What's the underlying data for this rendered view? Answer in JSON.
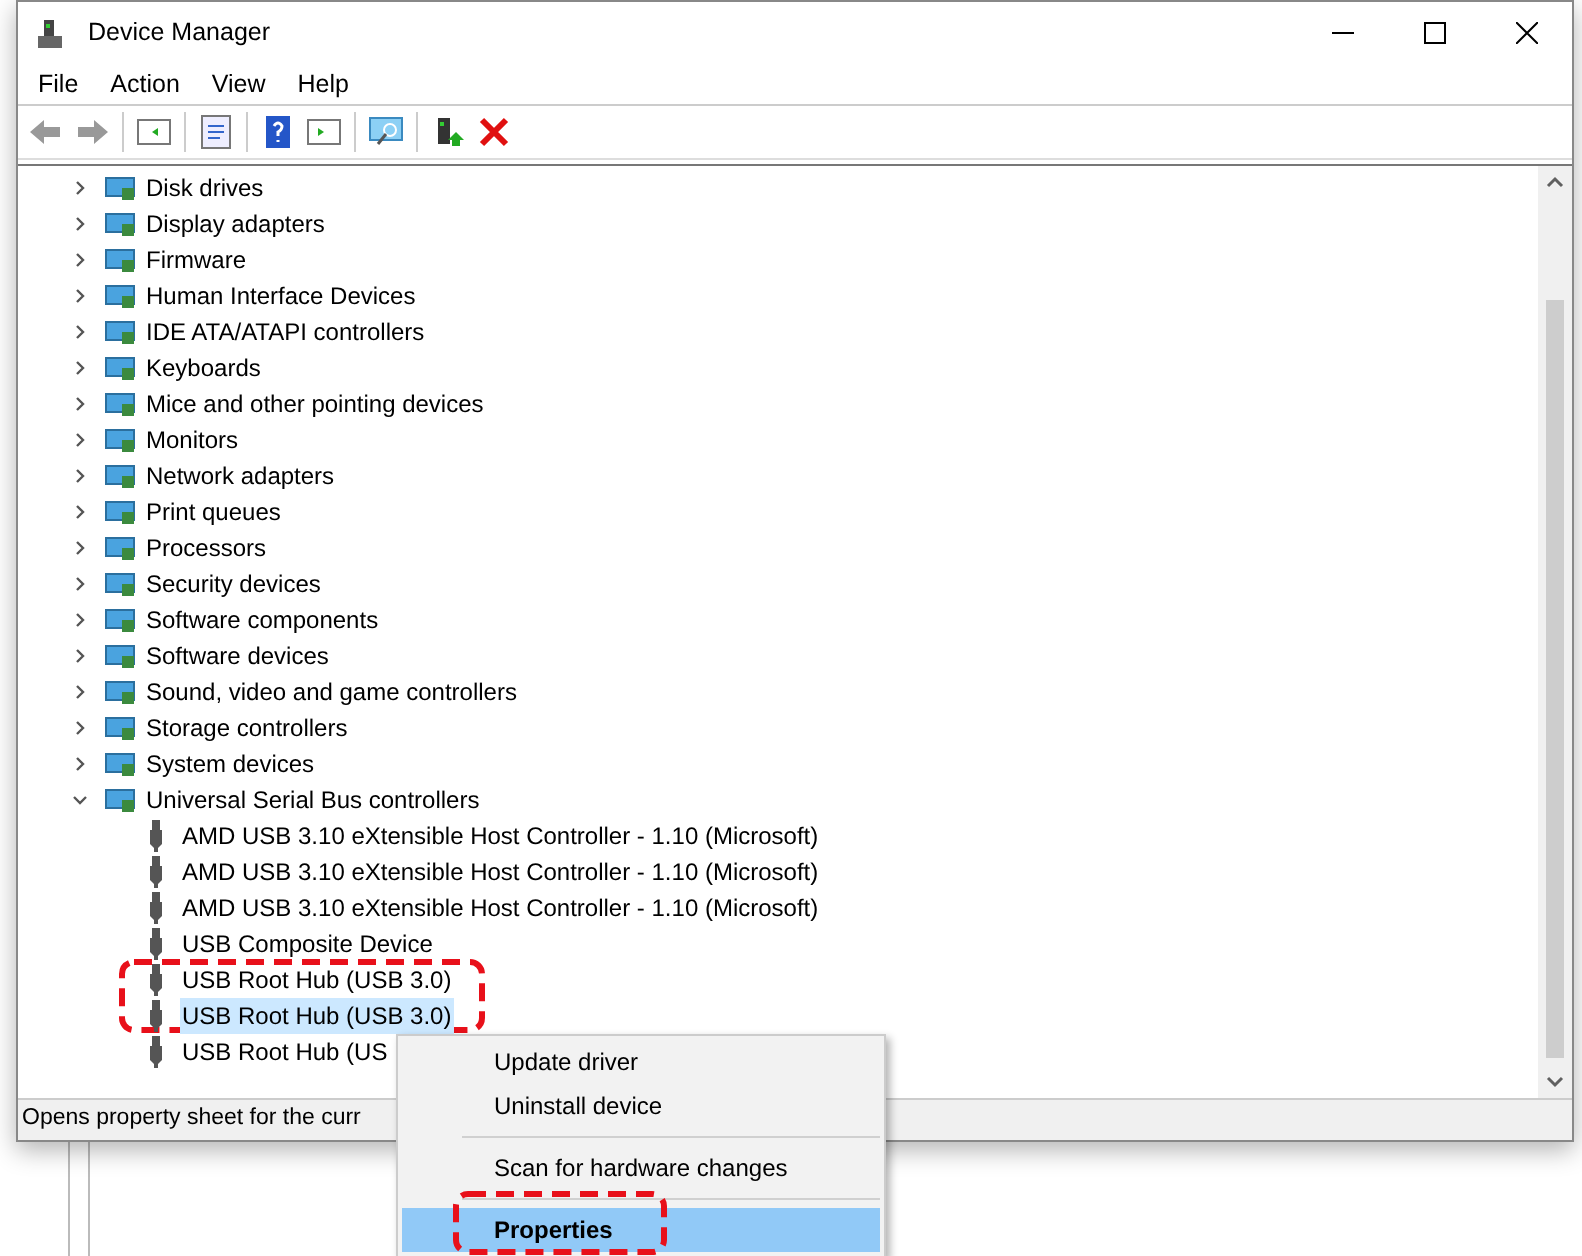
{
  "window": {
    "title": "Device Manager"
  },
  "menu_bar": [
    {
      "label": "File"
    },
    {
      "label": "Action"
    },
    {
      "label": "View"
    },
    {
      "label": "Help"
    }
  ],
  "tree": [
    {
      "label": "Disk drives",
      "expanded": false,
      "selected": false
    },
    {
      "label": "Display adapters",
      "expanded": false,
      "selected": false
    },
    {
      "label": "Firmware",
      "expanded": false,
      "selected": false
    },
    {
      "label": "Human Interface Devices",
      "expanded": false,
      "selected": false
    },
    {
      "label": "IDE ATA/ATAPI controllers",
      "expanded": false,
      "selected": false
    },
    {
      "label": "Keyboards",
      "expanded": false,
      "selected": false
    },
    {
      "label": "Mice and other pointing devices",
      "expanded": false,
      "selected": false
    },
    {
      "label": "Monitors",
      "expanded": false,
      "selected": false
    },
    {
      "label": "Network adapters",
      "expanded": false,
      "selected": false
    },
    {
      "label": "Print queues",
      "expanded": false,
      "selected": false
    },
    {
      "label": "Processors",
      "expanded": false,
      "selected": false
    },
    {
      "label": "Security devices",
      "expanded": false,
      "selected": false
    },
    {
      "label": "Software components",
      "expanded": false,
      "selected": false
    },
    {
      "label": "Software devices",
      "expanded": false,
      "selected": false
    },
    {
      "label": "Sound, video and game controllers",
      "expanded": false,
      "selected": false
    },
    {
      "label": "Storage controllers",
      "expanded": false,
      "selected": false
    },
    {
      "label": "System devices",
      "expanded": false,
      "selected": false
    },
    {
      "label": "Universal Serial Bus controllers",
      "expanded": true,
      "selected": false,
      "children": [
        {
          "label": "AMD USB 3.10 eXtensible Host Controller - 1.10 (Microsoft)",
          "selected": false
        },
        {
          "label": "AMD USB 3.10 eXtensible Host Controller - 1.10 (Microsoft)",
          "selected": false
        },
        {
          "label": "AMD USB 3.10 eXtensible Host Controller - 1.10 (Microsoft)",
          "selected": false
        },
        {
          "label": "USB Composite Device",
          "selected": false
        },
        {
          "label": "USB Root Hub (USB 3.0)",
          "selected": false
        },
        {
          "label": "USB Root Hub (USB 3.0)",
          "selected": true
        },
        {
          "label": "USB Root Hub (US",
          "selected": false
        }
      ]
    }
  ],
  "status_bar": "Opens property sheet for the curr",
  "context_menu": [
    {
      "kind": "item",
      "label": "Update driver",
      "selected": false,
      "default": false
    },
    {
      "kind": "item",
      "label": "Uninstall device",
      "selected": false,
      "default": false
    },
    {
      "kind": "separator"
    },
    {
      "kind": "item",
      "label": "Scan for hardware changes",
      "selected": false,
      "default": false
    },
    {
      "kind": "separator"
    },
    {
      "kind": "item",
      "label": "Properties",
      "selected": true,
      "default": true
    }
  ]
}
